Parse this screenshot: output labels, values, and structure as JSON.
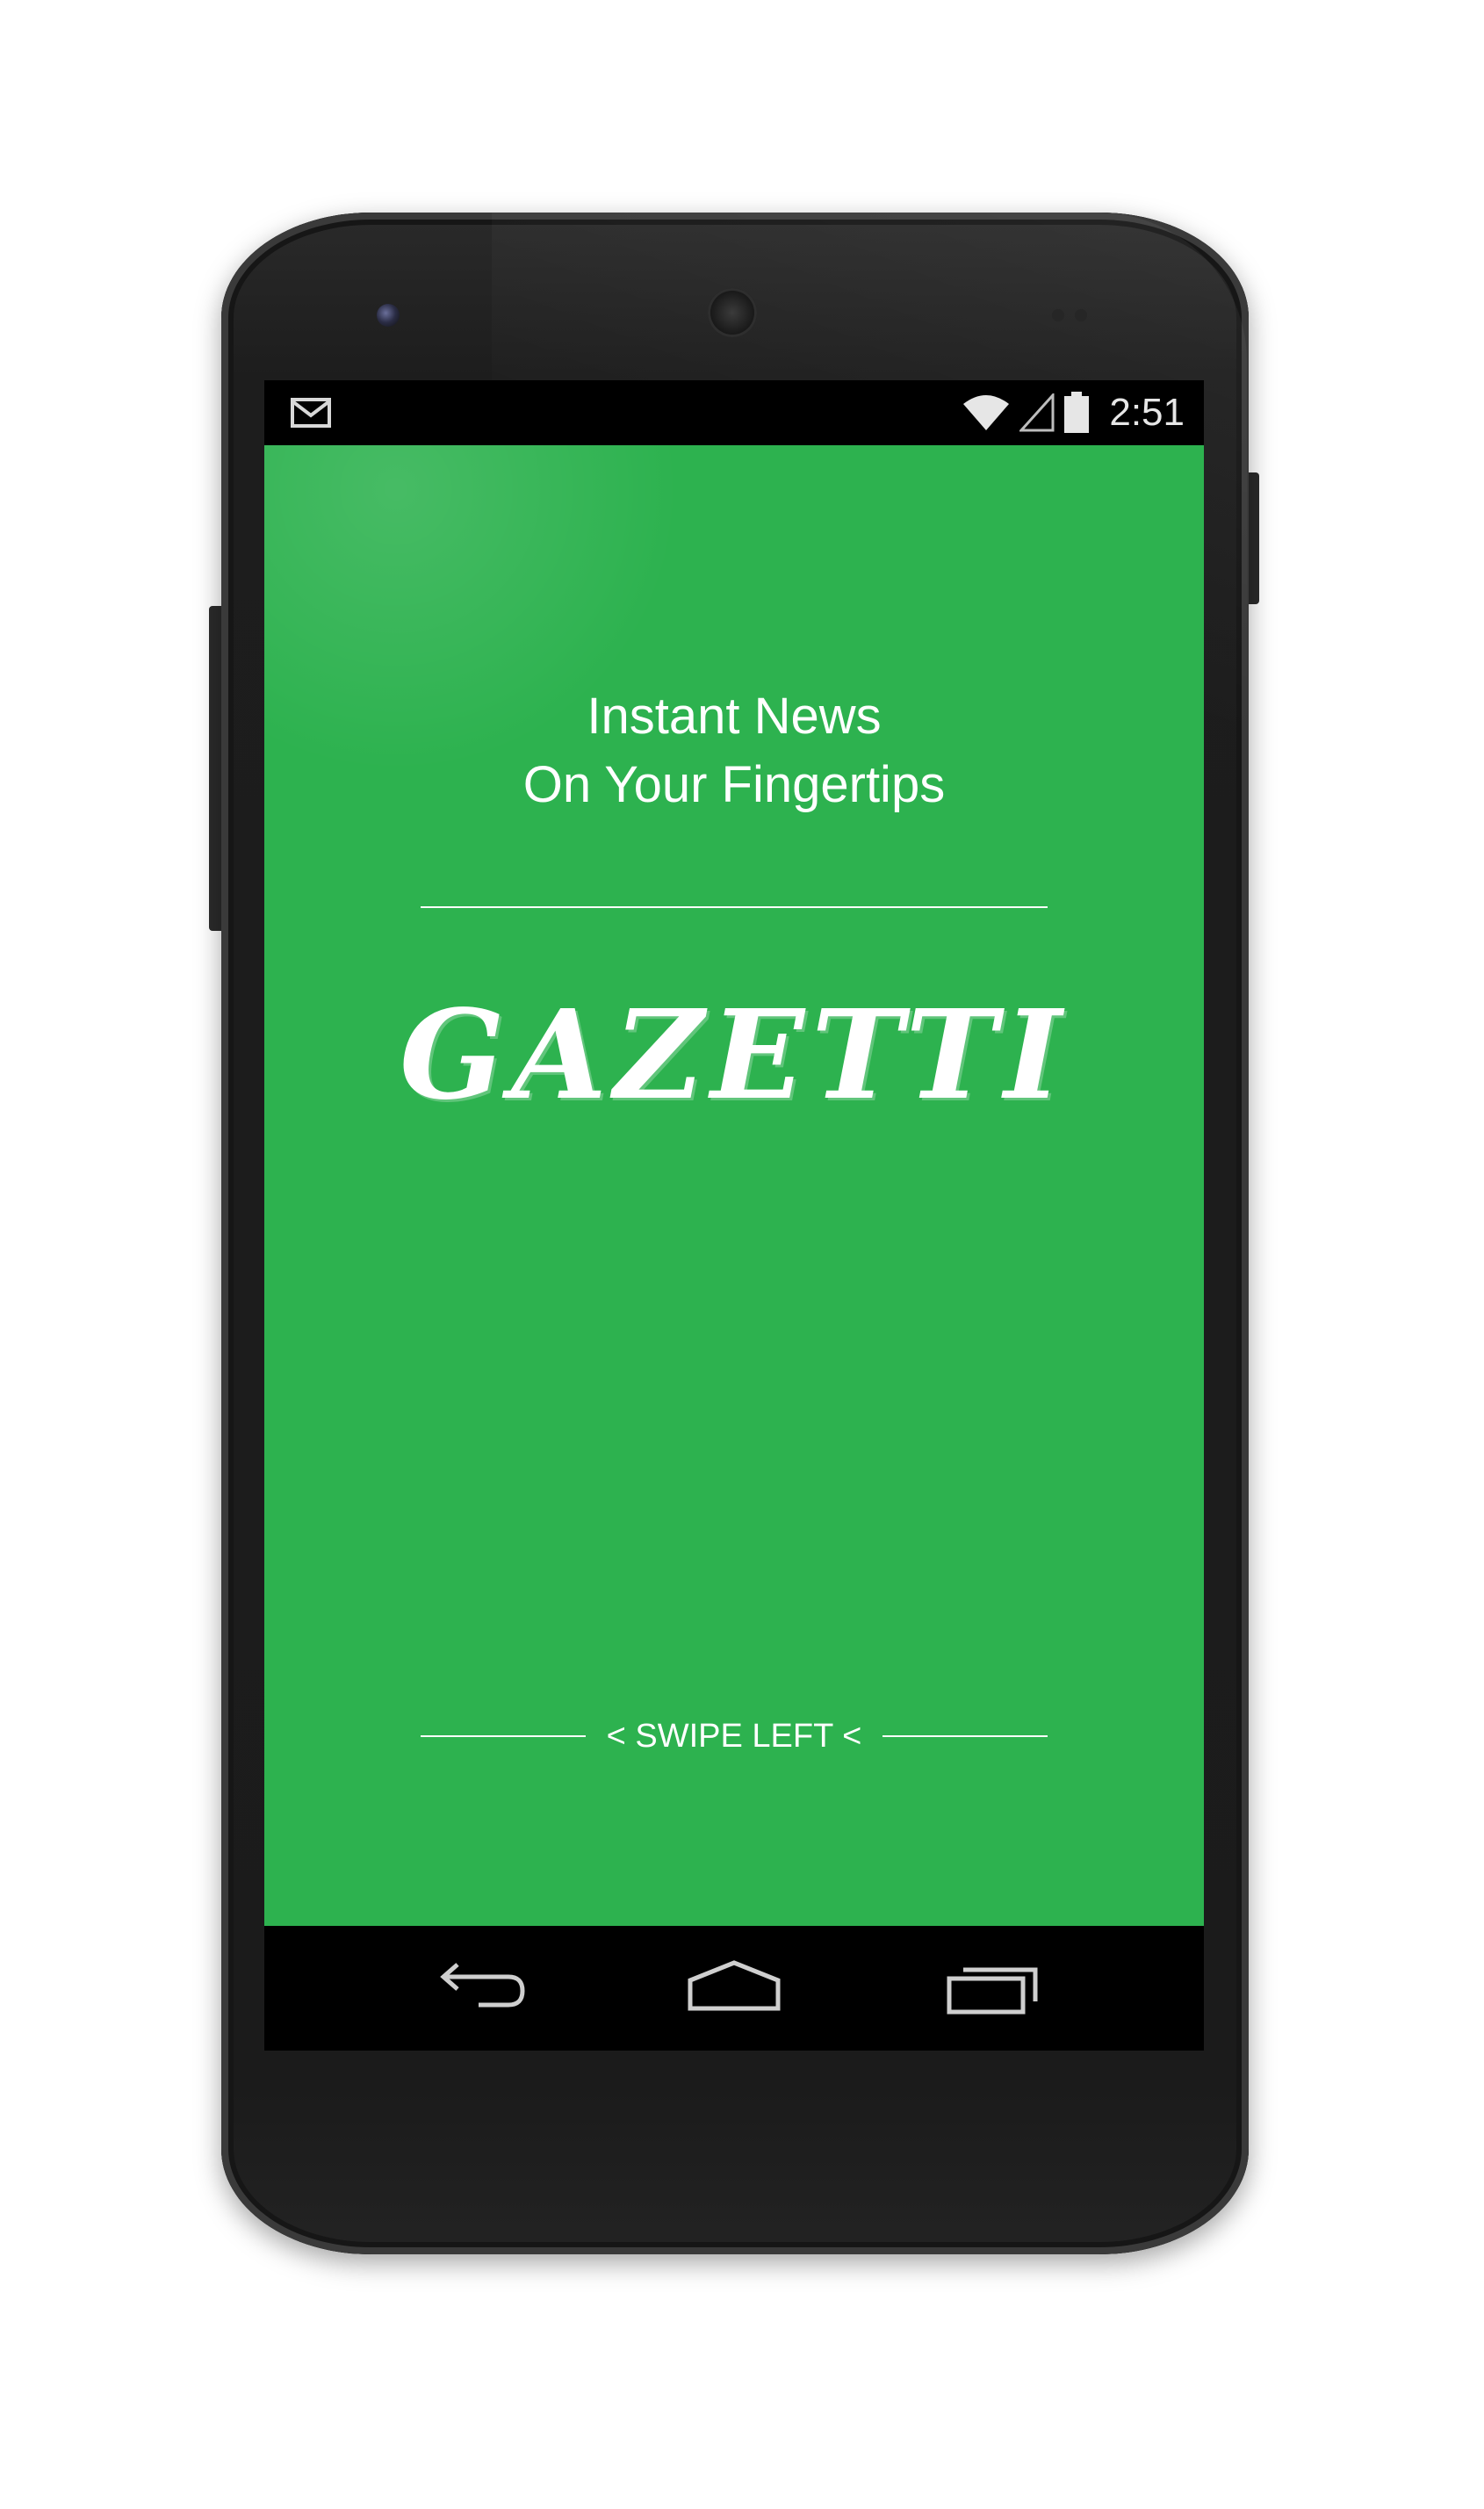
{
  "status_bar": {
    "time": "2:51",
    "notification_icon": "gmail-icon",
    "wifi_icon": "wifi-icon",
    "signal_icon": "cell-signal-icon",
    "battery_icon": "battery-icon"
  },
  "app": {
    "tagline_line1": "Instant News",
    "tagline_line2": "On Your Fingertips",
    "brand_name": "GAZETTI",
    "swipe_hint": "< SWIPE LEFT <",
    "background_color": "#2db24f"
  },
  "nav_bar": {
    "back_icon": "back-icon",
    "home_icon": "home-icon",
    "recents_icon": "recents-icon"
  }
}
